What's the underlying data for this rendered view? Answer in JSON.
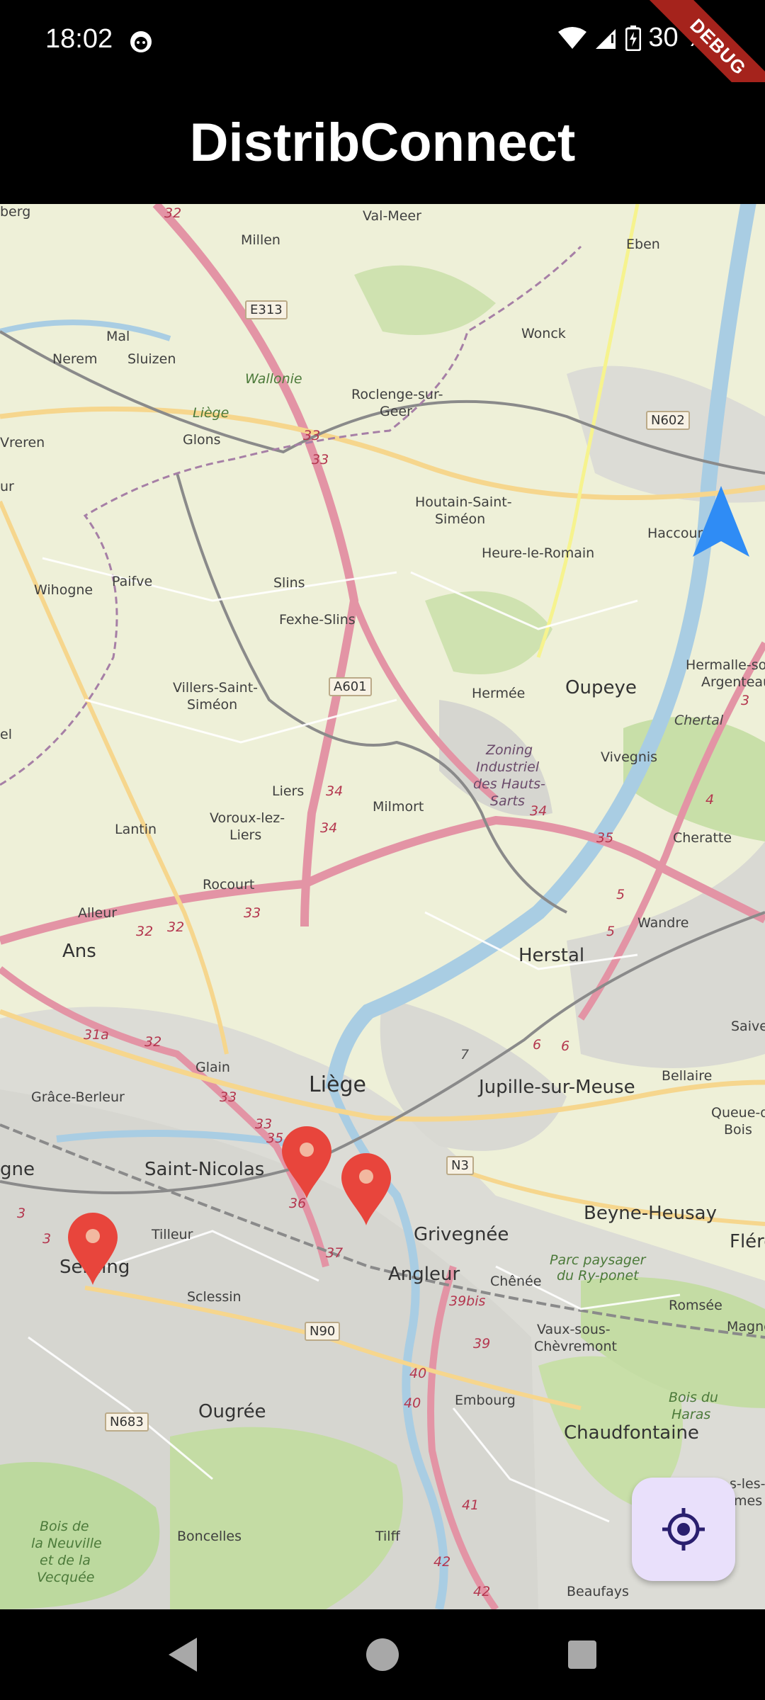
{
  "status": {
    "time": "18:02",
    "battery": "30 %",
    "debug": "DEBUG"
  },
  "app": {
    "title": "DistribConnect"
  },
  "map": {
    "places": {
      "millen": "Millen",
      "val_meer": "Val-Meer",
      "eben": "Eben",
      "mal": "Mal",
      "nerem": "Nerem",
      "sluizen": "Sluizen",
      "wallonie": "Wallonie",
      "liege_prov": "Liège",
      "glons": "Glons",
      "roclenge": "Roclenge-sur-",
      "geer": "Geer",
      "wonck": "Wonck",
      "vreren": "Vreren",
      "houtain": "Houtain-Saint-",
      "simeon": "Siméon",
      "heure": "Heure-le-Romain",
      "haccourt": "Haccour",
      "wihogne": "Wihogne",
      "paifve": "Paifve",
      "slins": "Slins",
      "fexhe": "Fexhe-Slins",
      "villers": "Villers-Saint-",
      "villers2": "Siméon",
      "hermee": "Hermée",
      "oupeye": "Oupeye",
      "hermalle": "Hermalle-sou",
      "argenteau": "Argenteau",
      "chertal": "Chertal",
      "zoning1": "Zoning",
      "zoning2": "Industriel",
      "zoning3": "des Hauts-",
      "zoning4": "Sarts",
      "vivegnis": "Vivegnis",
      "liers": "Liers",
      "milmort": "Milmort",
      "voroux": "Voroux-lez-",
      "voroux2": "Liers",
      "lantin": "Lantin",
      "cheratte": "Cheratte",
      "rocourt": "Rocourt",
      "alleur": "Alleur",
      "wandre": "Wandre",
      "ans": "Ans",
      "herstal": "Herstal",
      "saive": "Saive",
      "glain": "Glain",
      "liege": "Liège",
      "bellaire": "Bellaire",
      "grace": "Grâce-Berleur",
      "jupille": "Jupille-sur-Meuse",
      "queue": "Queue-du-",
      "bois": "Bois",
      "gne": "gne",
      "saint_nicolas": "Saint-Nicolas",
      "beyne": "Beyne-Heusay",
      "tilleur": "Tilleur",
      "grivegnee": "Grivegnée",
      "flero": "Fléro",
      "parc1": "Parc paysager",
      "parc2": "du Ry-ponet",
      "seraing": "Seraing",
      "angleur": "Angleur",
      "chenee": "Chênée",
      "sclessin": "Sclessin",
      "romsee": "Romsée",
      "magne": "Magne",
      "vaux": "Vaux-sous-",
      "chevremont": "Chèvremont",
      "bois_haras1": "Bois du",
      "bois_haras2": "Haras",
      "ougree": "Ougrée",
      "embourg": "Embourg",
      "chaudfontaine": "Chaudfontaine",
      "boncelles": "Boncelles",
      "tilff": "Tilff",
      "neuville1": "Bois de",
      "neuville2": "la Neuville",
      "neuville3": "et de la",
      "neuville4": "Vecquée",
      "beaufays": "Beaufays",
      "berg": "berg",
      "ur": "ur",
      "el": "el",
      "es": "s-les-",
      "mes": "mes"
    },
    "roads": {
      "e313": "E313",
      "n602": "N602",
      "a601": "A601",
      "n3": "N3",
      "n90": "N90",
      "n683": "N683",
      "r32a": "32",
      "r33a": "33",
      "r33b": "33",
      "r34a": "34",
      "r34b": "34",
      "r34c": "34",
      "r35a": "35",
      "r32b": "32",
      "r32c": "32",
      "r33c": "33",
      "r31a": "31a",
      "r32d": "32",
      "r33d": "33",
      "r33e": "33",
      "r35b": "35",
      "r36": "36",
      "r37": "37",
      "r3a": "3",
      "r3b": "3",
      "r39bis": "39bis",
      "r39": "39",
      "r40a": "40",
      "r40b": "40",
      "r41": "41",
      "r42a": "42",
      "r42b": "42",
      "r5a": "5",
      "r5b": "5",
      "r4": "4",
      "r3c": "3",
      "r6a": "6",
      "r6b": "6",
      "r7": "7"
    },
    "markers": [
      "map-pin",
      "map-pin",
      "map-pin"
    ],
    "colors": {
      "marker": "#e8453c",
      "arrow": "#2f8cf5",
      "accent": "#2a1f6e",
      "fab_bg": "#e9e0fb"
    }
  },
  "nav": {
    "back": "back-icon",
    "home": "home-icon",
    "recents": "recents-icon"
  }
}
